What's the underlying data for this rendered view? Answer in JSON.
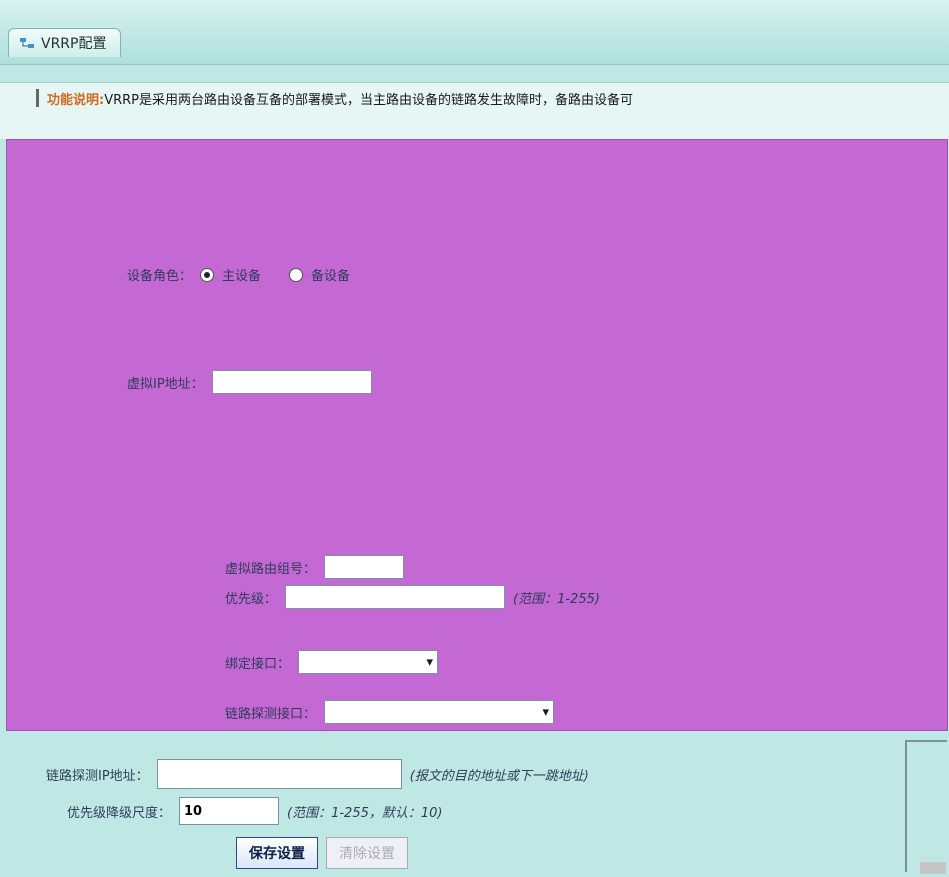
{
  "tab": {
    "title": "VRRP配置"
  },
  "info": {
    "title": "功能说明:",
    "text": "VRRP是采用两台路由设备互备的部署模式，当主路由设备的链路发生故障时，备路由设备可"
  },
  "panel": {
    "role": {
      "label": "设备角色：",
      "options": [
        "主设备",
        "备设备"
      ],
      "selected": 0
    },
    "virtual_ip": {
      "label": "虚拟IP地址：",
      "value": ""
    },
    "group": {
      "label": "虚拟路由组号：",
      "value": ""
    },
    "priority": {
      "label": "优先级：",
      "value": "",
      "hint": "(范围：1-255)"
    },
    "interface": {
      "label": "绑定接口：",
      "value": ""
    },
    "probe_iface": {
      "label": "链路探测接口：",
      "value": ""
    }
  },
  "form": {
    "probe_ip": {
      "label": "链路探测IP地址：",
      "value": "",
      "hint": "(报文的目的地址或下一跳地址)"
    },
    "decrement": {
      "label": "优先级降级尺度：",
      "value": "10",
      "hint": "(范围：1-255，默认：10)"
    },
    "save_label": "保存设置",
    "clear_label": "清除设置"
  },
  "colors": {
    "panel": "#c468d4",
    "background": "#bfe8e4",
    "accent": "#d2691e"
  }
}
